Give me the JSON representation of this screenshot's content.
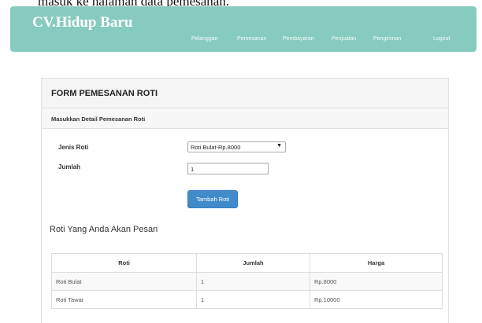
{
  "caption": "masuk ke halaman data pemesanan.",
  "navbar": {
    "brand": "CV.Hidup Baru",
    "links": [
      "Pelanggan",
      "Pemesanan",
      "Pembayaran",
      "Penjualan",
      "Pengiriman",
      "Logout"
    ],
    "color": "#87cbbf"
  },
  "form": {
    "title": "FORM PEMESANAN ROTI",
    "subtitle": "Masukkan Detail Pemesanan Roti",
    "jenis_label": "Jenis Roti",
    "jenis_value": "Roti Bulat-Rp.8000",
    "jumlah_label": "Jumlah",
    "jumlah_value": "1",
    "add_button": "Tambah Roti",
    "button_color": "#428bca"
  },
  "order_list": {
    "heading": "Roti Yang Anda Akan Pesan",
    "columns": [
      "Roti",
      "Jumlah",
      "Harga"
    ],
    "rows": [
      [
        "Roti Bulat",
        "1",
        "Rp.8000"
      ],
      [
        "Roti Tawar",
        "1",
        "Rp.10000"
      ]
    ]
  }
}
